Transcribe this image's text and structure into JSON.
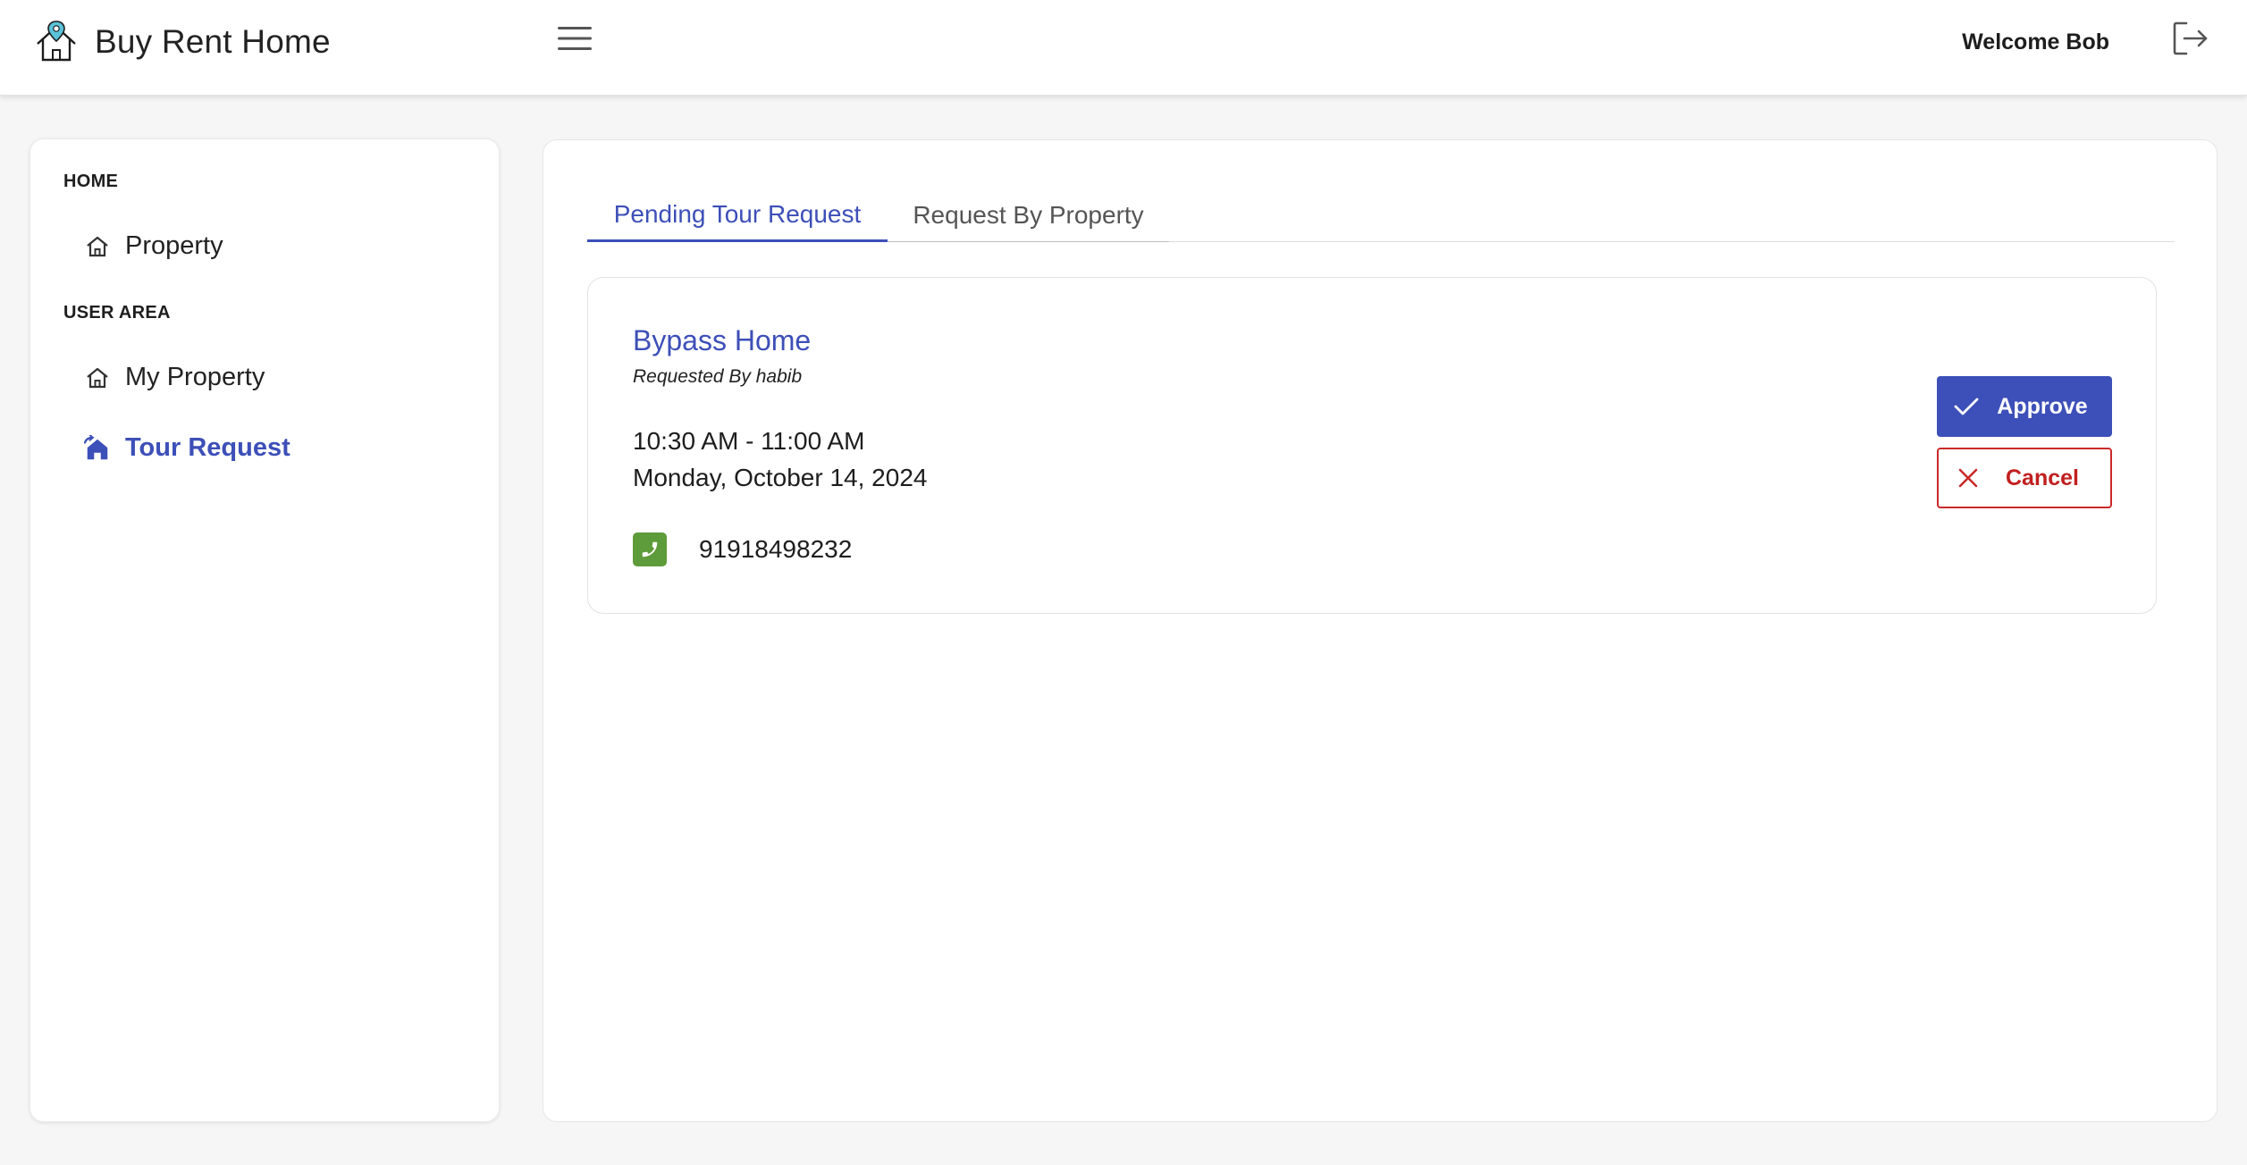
{
  "header": {
    "app_title": "Buy Rent Home",
    "welcome_text": "Welcome Bob",
    "logo_icon": "house-location-pin-icon",
    "menu_icon": "hamburger-menu-icon",
    "logout_icon": "logout-icon"
  },
  "sidebar": {
    "sections": [
      {
        "title": "HOME",
        "items": [
          {
            "label": "Property",
            "icon": "home-outline-icon",
            "active": false
          }
        ]
      },
      {
        "title": "USER AREA",
        "items": [
          {
            "label": "My Property",
            "icon": "home-outline-icon",
            "active": false
          },
          {
            "label": "Tour Request",
            "icon": "house-arrow-icon",
            "active": true
          }
        ]
      }
    ]
  },
  "main": {
    "tabs": [
      {
        "label": "Pending Tour Request",
        "active": true
      },
      {
        "label": "Request By Property",
        "active": false
      }
    ],
    "requests": [
      {
        "property_name": "Bypass Home",
        "requested_by": "Requested By habib",
        "time_range": "10:30 AM - 11:00 AM",
        "date": "Monday, October 14, 2024",
        "phone": "91918498232",
        "approve_label": "Approve",
        "cancel_label": "Cancel"
      }
    ]
  },
  "colors": {
    "accent": "#3d4fb8",
    "danger": "#c92a2a",
    "phone_badge": "#5e9b3a",
    "background": "#f6f6f6"
  }
}
